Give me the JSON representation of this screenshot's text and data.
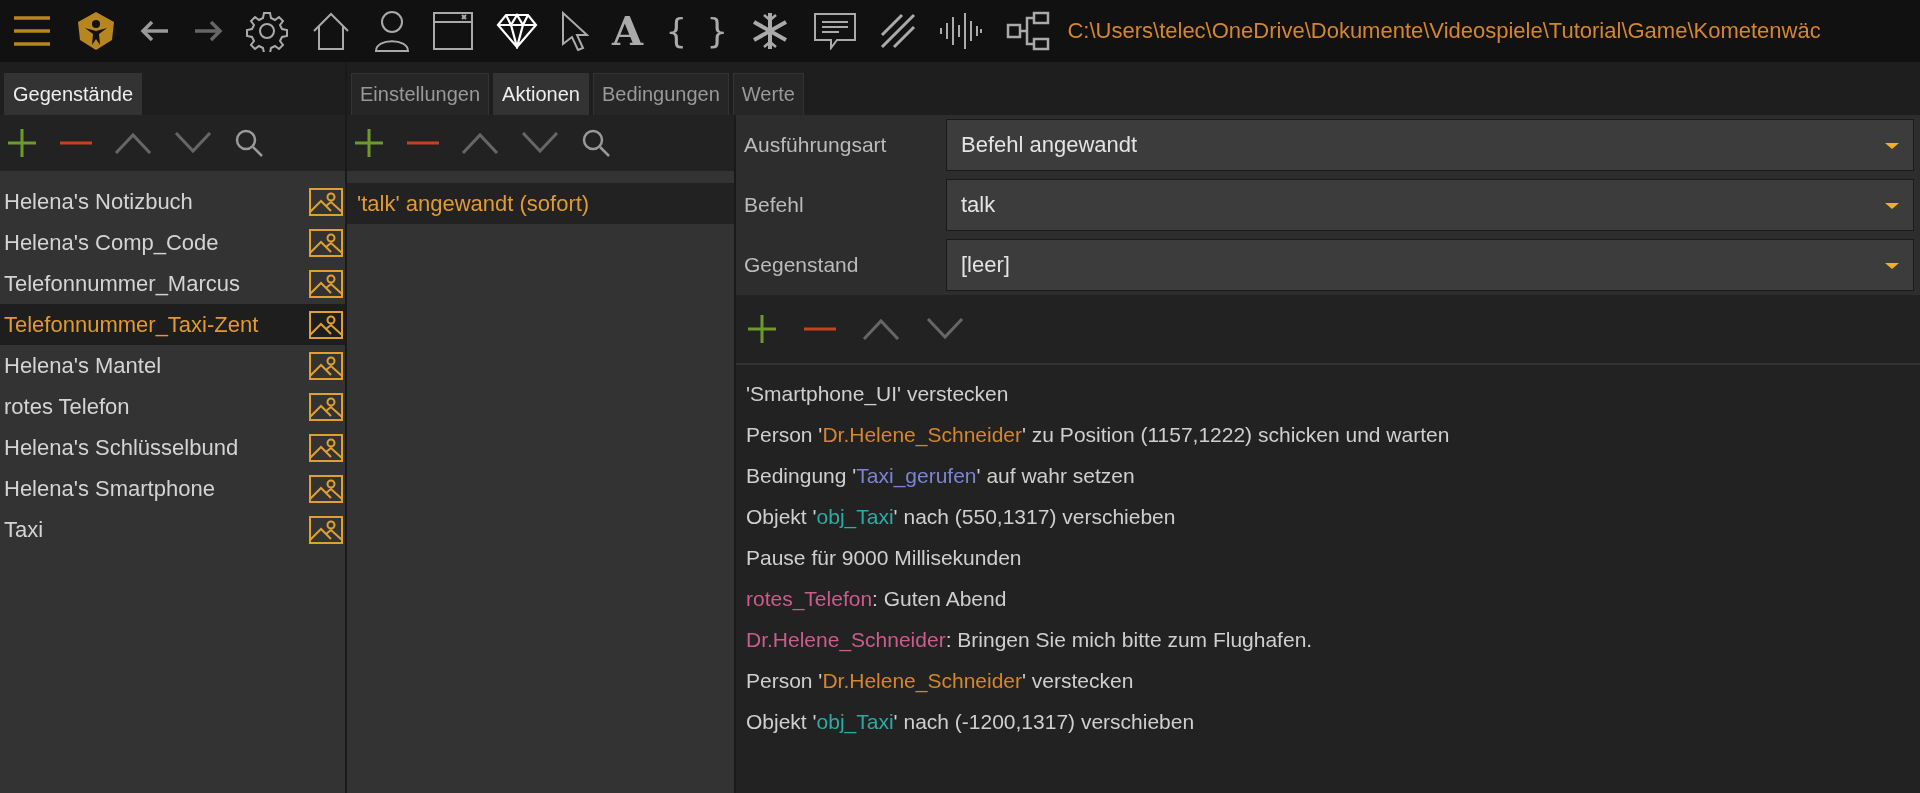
{
  "toolbar": {
    "letter_glyph": "A",
    "braces_glyph": "{ }",
    "path": "C:\\Users\\telec\\OneDrive\\Dokumente\\Videospiele\\Tutorial\\Game\\Kometenwäc"
  },
  "items_panel": {
    "tabs": [
      {
        "label": "Gegenstände",
        "selected": true
      }
    ],
    "items": [
      {
        "label": "Helena's Notizbuch",
        "selected": false
      },
      {
        "label": "Helena's Comp_Code",
        "selected": false
      },
      {
        "label": "Telefonnummer_Marcus",
        "selected": false
      },
      {
        "label": "Telefonnummer_Taxi-Zent",
        "selected": true
      },
      {
        "label": "Helena's Mantel",
        "selected": false
      },
      {
        "label": "rotes Telefon",
        "selected": false
      },
      {
        "label": "Helena's Schlüsselbund",
        "selected": false
      },
      {
        "label": "Helena's Smartphone",
        "selected": false
      },
      {
        "label": "Taxi",
        "selected": false
      }
    ]
  },
  "actions_panel": {
    "tabs": [
      {
        "label": "Einstellungen",
        "selected": false
      },
      {
        "label": "Aktionen",
        "selected": true
      },
      {
        "label": "Bedingungen",
        "selected": false
      },
      {
        "label": "Werte",
        "selected": false
      }
    ],
    "items": [
      {
        "label": "'talk' angewandt (sofort)",
        "selected": true
      }
    ]
  },
  "detail": {
    "fields": [
      {
        "label": "Ausführungsart",
        "value": "Befehl angewandt"
      },
      {
        "label": "Befehl",
        "value": "talk"
      },
      {
        "label": "Gegenstand",
        "value": "[leer]"
      }
    ],
    "script_lines": [
      [
        {
          "text": "'Smartphone_UI' verstecken",
          "color": "#cfcfcf"
        }
      ],
      [
        {
          "text": "Person '",
          "color": "#cfcfcf"
        },
        {
          "text": "Dr.Helene_Schneider",
          "color": "#d6862a"
        },
        {
          "text": "' zu Position (1157,1222) schicken und warten",
          "color": "#cfcfcf"
        }
      ],
      [
        {
          "text": "Bedingung '",
          "color": "#cfcfcf"
        },
        {
          "text": "Taxi_gerufen",
          "color": "#7d84d2"
        },
        {
          "text": "' auf wahr setzen",
          "color": "#cfcfcf"
        }
      ],
      [
        {
          "text": "Objekt '",
          "color": "#cfcfcf"
        },
        {
          "text": "obj_Taxi",
          "color": "#2eaaa6"
        },
        {
          "text": "' nach (550,1317) verschieben",
          "color": "#cfcfcf"
        }
      ],
      [
        {
          "text": "Pause für 9000 Millisekunden",
          "color": "#cfcfcf"
        }
      ],
      [
        {
          "text": "rotes_Telefon",
          "color": "#cc5c8c"
        },
        {
          "text": ": Guten Abend",
          "color": "#cfcfcf"
        }
      ],
      [
        {
          "text": "Dr.Helene_Schneider",
          "color": "#cc5c8c"
        },
        {
          "text": ": Bringen Sie mich bitte zum Flughafen.",
          "color": "#cfcfcf"
        }
      ],
      [
        {
          "text": "Person '",
          "color": "#cfcfcf"
        },
        {
          "text": "Dr.Helene_Schneider",
          "color": "#d6862a"
        },
        {
          "text": "' verstecken",
          "color": "#cfcfcf"
        }
      ],
      [
        {
          "text": "Objekt '",
          "color": "#cfcfcf"
        },
        {
          "text": "obj_Taxi",
          "color": "#2eaaa6"
        },
        {
          "text": "' nach (-1200,1317) verschieben",
          "color": "#cfcfcf"
        }
      ]
    ]
  }
}
